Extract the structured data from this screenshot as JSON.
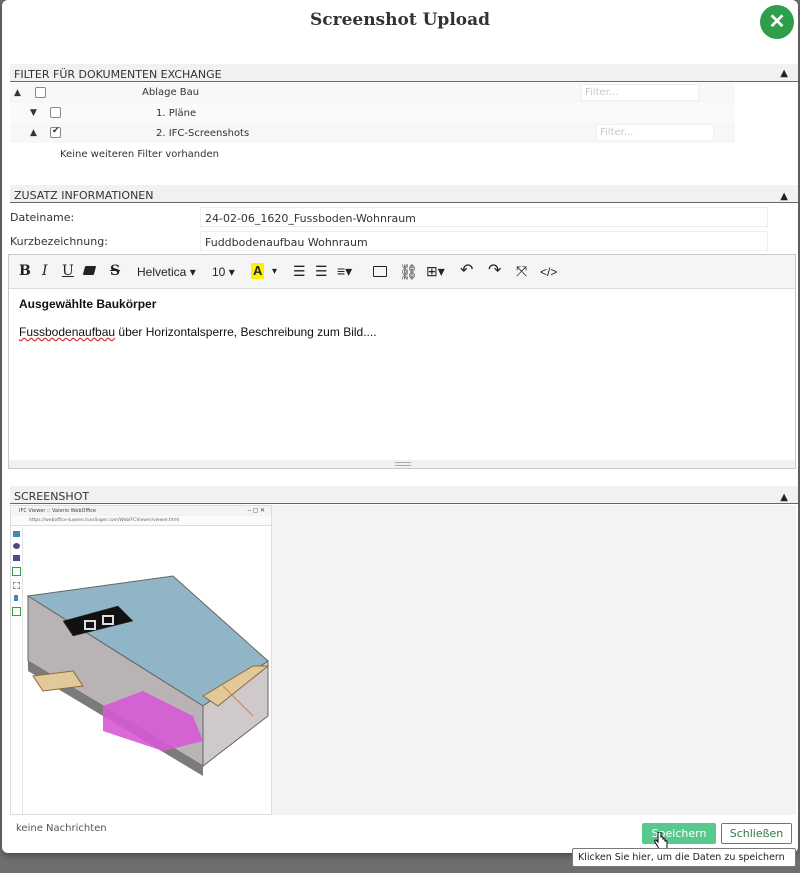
{
  "dialog": {
    "title": "Screenshot Upload",
    "close_symbol": "✕"
  },
  "filter": {
    "header": "FILTER FÜR DOKUMENTEN EXCHANGE",
    "tree": [
      {
        "label": "Ablage Bau",
        "checked": false,
        "expanded": true,
        "filter_placeholder": "Filter..."
      },
      {
        "label": "1. Pläne",
        "checked": false,
        "expanded": false
      },
      {
        "label": "2. IFC-Screenshots",
        "checked": true,
        "expanded": true,
        "filter_placeholder": "Filter..."
      }
    ],
    "no_more": "Keine weiteren Filter vorhanden"
  },
  "info": {
    "header": "ZUSATZ INFORMATIONEN",
    "filename_label": "Dateiname:",
    "filename_value": "24-02-06_1620_Fussboden-Wohnraum",
    "short_label": "Kurzbezeichnung:",
    "short_value": "Fuddbodenaufbau Wohnraum"
  },
  "editor": {
    "font": "Helvetica",
    "size": "10",
    "heading": "Ausgewählte Baukörper",
    "body_word1": "Fussbodenaufbau",
    "body_rest": " über Horizontalsperre, Beschreibung zum Bild...."
  },
  "screenshot": {
    "header": "SCREENSHOT",
    "window_title": "IFC Viewer :: Valerio WebOffice",
    "url": "https://weboffice-tuwien.fuxslinger.com/WebIFCViewer/viewer.html"
  },
  "footer": {
    "status": "keine Nachrichten",
    "save_label": "Speichern",
    "close_label": "Schließen",
    "tooltip": "Klicken Sie hier, um die Daten zu speichern"
  },
  "colors": {
    "accent": "#2e9e4a",
    "save": "#58c98e",
    "roof": "#8fb5c6",
    "floor": "#d65ad6"
  }
}
